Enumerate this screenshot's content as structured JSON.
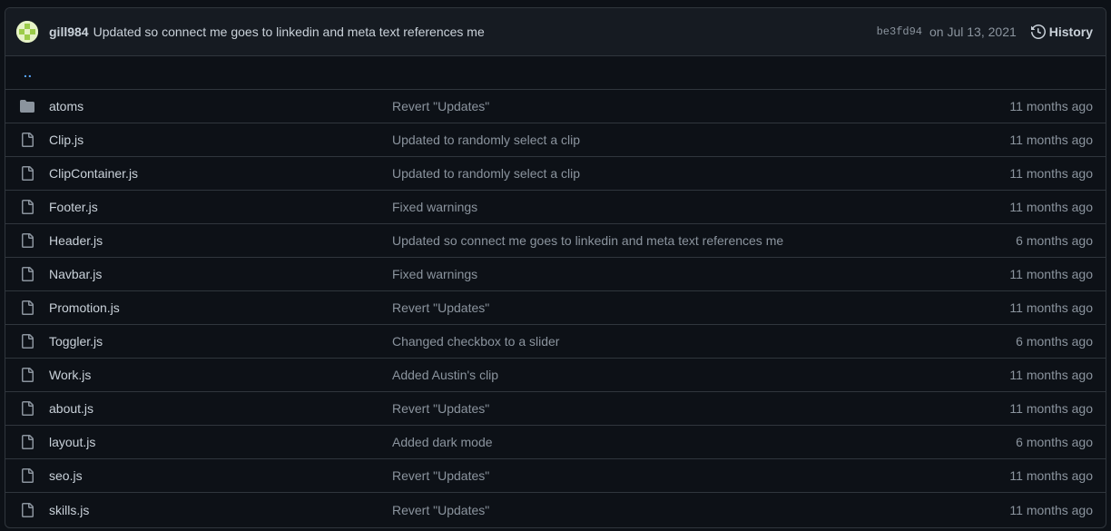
{
  "header": {
    "author": "gill984",
    "commit_message": "Updated so connect me goes to linkedin and meta text references me",
    "sha": "be3fd94",
    "date": "on Jul 13, 2021",
    "history_label": "History"
  },
  "parent_dir": "..",
  "files": [
    {
      "type": "folder",
      "name": "atoms",
      "message": "Revert \"Updates\"",
      "age": "11 months ago"
    },
    {
      "type": "file",
      "name": "Clip.js",
      "message": "Updated to randomly select a clip",
      "age": "11 months ago"
    },
    {
      "type": "file",
      "name": "ClipContainer.js",
      "message": "Updated to randomly select a clip",
      "age": "11 months ago"
    },
    {
      "type": "file",
      "name": "Footer.js",
      "message": "Fixed warnings",
      "age": "11 months ago"
    },
    {
      "type": "file",
      "name": "Header.js",
      "message": "Updated so connect me goes to linkedin and meta text references me",
      "age": "6 months ago"
    },
    {
      "type": "file",
      "name": "Navbar.js",
      "message": "Fixed warnings",
      "age": "11 months ago"
    },
    {
      "type": "file",
      "name": "Promotion.js",
      "message": "Revert \"Updates\"",
      "age": "11 months ago"
    },
    {
      "type": "file",
      "name": "Toggler.js",
      "message": "Changed checkbox to a slider",
      "age": "6 months ago"
    },
    {
      "type": "file",
      "name": "Work.js",
      "message": "Added Austin's clip",
      "age": "11 months ago"
    },
    {
      "type": "file",
      "name": "about.js",
      "message": "Revert \"Updates\"",
      "age": "11 months ago"
    },
    {
      "type": "file",
      "name": "layout.js",
      "message": "Added dark mode",
      "age": "6 months ago"
    },
    {
      "type": "file",
      "name": "seo.js",
      "message": "Revert \"Updates\"",
      "age": "11 months ago"
    },
    {
      "type": "file",
      "name": "skills.js",
      "message": "Revert \"Updates\"",
      "age": "11 months ago"
    }
  ],
  "colors": {
    "background": "#0d1117",
    "header_bg": "#161b22",
    "border": "#30363d",
    "text": "#c9d1d9",
    "muted": "#8b949e",
    "link": "#58a6ff"
  }
}
